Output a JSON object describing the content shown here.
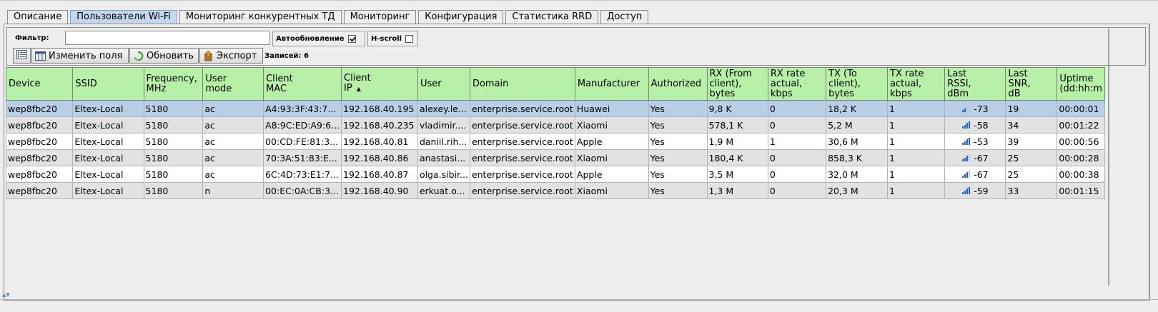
{
  "tabs": [
    {
      "label": "Описание",
      "active": false
    },
    {
      "label": "Пользователи Wi-Fi",
      "active": true
    },
    {
      "label": "Мониторинг конкурентных ТД",
      "active": false
    },
    {
      "label": "Мониторинг",
      "active": false
    },
    {
      "label": "Конфигурация",
      "active": false
    },
    {
      "label": "Статистика RRD",
      "active": false
    },
    {
      "label": "Доступ",
      "active": false
    }
  ],
  "toolbar": {
    "filter_label": "Фильтр:",
    "filter_value": "",
    "autorefresh_label": "Автообновление",
    "autorefresh_checked": true,
    "hscroll_label": "H-scroll",
    "hscroll_checked": false,
    "columns_icon": "list-view-icon",
    "edit_fields_label": "Изменить поля",
    "edit_fields_icon": "columns-icon",
    "refresh_label": "Обновить",
    "refresh_icon": "refresh-icon",
    "export_label": "Экспорт",
    "export_icon": "export-icon",
    "records_label": "Записей: 6"
  },
  "colors": {
    "header_bg": "#b7f0a7",
    "selected_row": "#b8cfe7",
    "active_tab": "#c3d8f0",
    "signal_on": "#1a5fd6",
    "signal_off": "#b9c7dd"
  },
  "table": {
    "columns": [
      {
        "lines": [
          "Device"
        ]
      },
      {
        "lines": [
          "SSID"
        ]
      },
      {
        "lines": [
          "Frequency,",
          "MHz"
        ]
      },
      {
        "lines": [
          "User",
          "mode"
        ]
      },
      {
        "lines": [
          "Client",
          "MAC"
        ]
      },
      {
        "lines": [
          "Client",
          "IP"
        ],
        "sorted": "asc"
      },
      {
        "lines": [
          "User"
        ]
      },
      {
        "lines": [
          "Domain"
        ]
      },
      {
        "lines": [
          "Manufacturer"
        ]
      },
      {
        "lines": [
          "Authorized"
        ]
      },
      {
        "lines": [
          "RX (From",
          "client),",
          "bytes"
        ]
      },
      {
        "lines": [
          "RX rate",
          "actual,",
          "kbps"
        ]
      },
      {
        "lines": [
          "TX (To",
          "client),",
          "bytes"
        ]
      },
      {
        "lines": [
          "TX rate",
          "actual,",
          "kbps"
        ]
      },
      {
        "lines": [
          "Last",
          "RSSI,",
          "dBm"
        ]
      },
      {
        "lines": [
          "Last",
          "SNR,",
          "dB"
        ]
      },
      {
        "lines": [
          "Uptime",
          "(dd:hh:m"
        ]
      }
    ],
    "rows": [
      {
        "selected": true,
        "signal_bars": 2,
        "cells": [
          "wep8fbc20",
          "Eltex-Local",
          "5180",
          "ac",
          "A4:93:3F:43:7...",
          "192.168.40.195",
          "alexey.le...",
          "enterprise.service.root",
          "Huawei",
          "Yes",
          "9,8 K",
          "0",
          "18,2 K",
          "1",
          "-73",
          "19",
          "00:00:01"
        ]
      },
      {
        "selected": false,
        "signal_bars": 4,
        "cells": [
          "wep8fbc20",
          "Eltex-Local",
          "5180",
          "ac",
          "A8:9C:ED:A9:6...",
          "192.168.40.235",
          "vladimir....",
          "enterprise.service.root",
          "Xiaomi",
          "Yes",
          "578,1 K",
          "0",
          "5,2 M",
          "1",
          "-58",
          "34",
          "00:01:22"
        ]
      },
      {
        "selected": false,
        "signal_bars": 4,
        "cells": [
          "wep8fbc20",
          "Eltex-Local",
          "5180",
          "ac",
          "00:CD:FE:81:3...",
          "192.168.40.81",
          "daniil.rih...",
          "enterprise.service.root",
          "Apple",
          "Yes",
          "1,9 M",
          "1",
          "30,6 M",
          "1",
          "-53",
          "39",
          "00:00:56"
        ]
      },
      {
        "selected": false,
        "signal_bars": 3,
        "cells": [
          "wep8fbc20",
          "Eltex-Local",
          "5180",
          "ac",
          "70:3A:51:83:E...",
          "192.168.40.86",
          "anastasi...",
          "enterprise.service.root",
          "Xiaomi",
          "Yes",
          "180,4 K",
          "0",
          "858,3 K",
          "1",
          "-67",
          "25",
          "00:00:28"
        ]
      },
      {
        "selected": false,
        "signal_bars": 3,
        "cells": [
          "wep8fbc20",
          "Eltex-Local",
          "5180",
          "ac",
          "6C:4D:73:E1:7...",
          "192.168.40.87",
          "olga.sibir...",
          "enterprise.service.root",
          "Apple",
          "Yes",
          "3,5 M",
          "0",
          "32,0 M",
          "1",
          "-67",
          "25",
          "00:00:38"
        ]
      },
      {
        "selected": false,
        "signal_bars": 4,
        "cells": [
          "wep8fbc20",
          "Eltex-Local",
          "5180",
          "n",
          "00:EC:0A:CB:3...",
          "192.168.40.90",
          "erkuat.o...",
          "enterprise.service.root",
          "Xiaomi",
          "Yes",
          "1,3 M",
          "0",
          "20,3 M",
          "1",
          "-59",
          "33",
          "00:01:15"
        ]
      }
    ]
  }
}
